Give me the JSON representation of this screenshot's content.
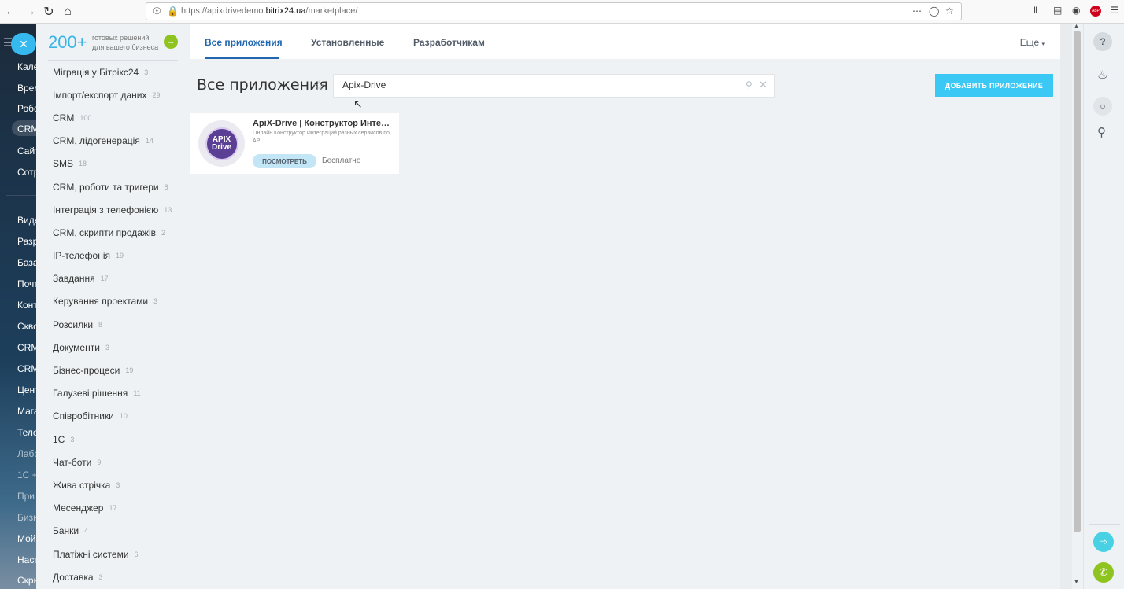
{
  "browser": {
    "url_prefix": "https://apixdrivedemo.",
    "url_domain": "bitrix24.ua",
    "url_path": "/marketplace/"
  },
  "left_menu": {
    "items": [
      "Кале",
      "Врем",
      "Робо",
      "CRM",
      "Сайт",
      "Сотр",
      "Виде",
      "Разр",
      "База",
      "Почт",
      "Конт",
      "Скво",
      "CRM",
      "CRM",
      "Цент",
      "Мага",
      "Теле",
      "Лабо",
      "1С +",
      "При",
      "Бизн",
      "Мой",
      "Наст",
      "Скры"
    ]
  },
  "promo": {
    "number": "200+",
    "line1": "готовых решений",
    "line2": "для вашего бизнеса"
  },
  "categories": [
    {
      "name": "Міграція у Бітрікс24",
      "count": "3"
    },
    {
      "name": "Імпорт/експорт даних",
      "count": "29"
    },
    {
      "name": "CRM",
      "count": "100"
    },
    {
      "name": "CRM, лідогенерація",
      "count": "14"
    },
    {
      "name": "SMS",
      "count": "18"
    },
    {
      "name": "CRM, роботи та тригери",
      "count": "8"
    },
    {
      "name": "Інтеграція з телефонією",
      "count": "13"
    },
    {
      "name": "CRM, скрипти продажів",
      "count": "2"
    },
    {
      "name": "IP-телефонія",
      "count": "19"
    },
    {
      "name": "Завдання",
      "count": "17"
    },
    {
      "name": "Керування проектами",
      "count": "3"
    },
    {
      "name": "Розсилки",
      "count": "8"
    },
    {
      "name": "Документи",
      "count": "3"
    },
    {
      "name": "Бізнес-процеси",
      "count": "19"
    },
    {
      "name": "Галузеві рішення",
      "count": "11"
    },
    {
      "name": "Співробітники",
      "count": "10"
    },
    {
      "name": "1С",
      "count": "3"
    },
    {
      "name": "Чат-боти",
      "count": "9"
    },
    {
      "name": "Жива стрічка",
      "count": "3"
    },
    {
      "name": "Месенджер",
      "count": "17"
    },
    {
      "name": "Банки",
      "count": "4"
    },
    {
      "name": "Платіжні системи",
      "count": "6"
    },
    {
      "name": "Доставка",
      "count": "3"
    }
  ],
  "tabs": {
    "all": "Все приложения",
    "installed": "Установленные",
    "developers": "Разработчикам",
    "more": "Еще"
  },
  "page_title": "Все приложения",
  "search": {
    "value": "Apix-Drive"
  },
  "add_button": "ДОБАВИТЬ ПРИЛОЖЕНИЕ",
  "app_card": {
    "logo_line1": "APIX",
    "logo_line2": "Drive",
    "name": "ApiX-Drive | Конструктор Интеграций",
    "description": "Онлайн Конструктор Интеграций разных сервисов по API",
    "view_button": "ПОСМОТРЕТЬ",
    "price": "Бесплатно"
  },
  "icons": [
    "back-icon",
    "forward-icon",
    "reload-icon",
    "home-icon",
    "shield-icon",
    "lock-icon",
    "more-dots-icon",
    "pocket-icon",
    "bookmark-star-icon",
    "library-icon",
    "sidebar-icon",
    "account-icon",
    "adblock-icon",
    "hamburger-icon",
    "close-icon",
    "favorite-star-icon",
    "search-icon",
    "clear-icon",
    "help-icon",
    "bell-icon",
    "chat-icon",
    "search-icon",
    "transfer-icon",
    "phone-icon"
  ],
  "colors": {
    "accent": "#3bc8f5",
    "tab_active": "#2067b0",
    "promo_green": "#8fc31f",
    "app_logo": "#5b3f94"
  }
}
